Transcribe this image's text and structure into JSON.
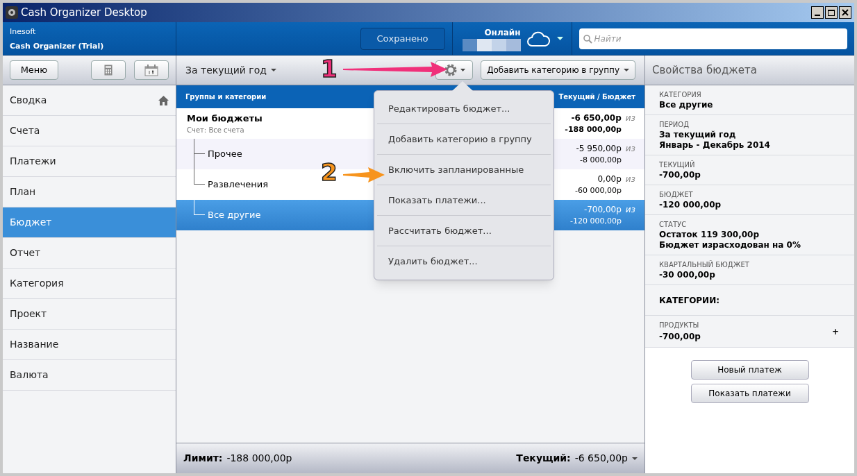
{
  "window": {
    "title": "Cash Organizer Desktop"
  },
  "header": {
    "company": "Inesoft",
    "product": "Cash Organizer (Trial)",
    "save_button": "Сохранено",
    "sync_status": "Онлайн",
    "search": {
      "placeholder": "Найти"
    }
  },
  "toolbar": {
    "menu_button": "Меню",
    "period": "За текущий год",
    "add_category_button": "Добавить категорию в группу",
    "panel_title": "Свойства бюджета"
  },
  "sidebar": {
    "items": [
      {
        "label": "Сводка",
        "selected": false,
        "home": true
      },
      {
        "label": "Счета",
        "selected": false
      },
      {
        "label": "Платежи",
        "selected": false
      },
      {
        "label": "План",
        "selected": false
      },
      {
        "label": "Бюджет",
        "selected": true
      },
      {
        "label": "Отчет",
        "selected": false
      },
      {
        "label": "Категория",
        "selected": false
      },
      {
        "label": "Проект",
        "selected": false
      },
      {
        "label": "Название",
        "selected": false
      },
      {
        "label": "Валюта",
        "selected": false
      }
    ]
  },
  "table": {
    "columns": [
      "Группы и категории",
      "Текущий / Бюджет"
    ],
    "rows": [
      {
        "name": "Мои бюджеты",
        "subtitle": "Счет: Все счета",
        "current": "-6 650,00р",
        "of": "из",
        "budget": "-188 000,00р",
        "selected": false,
        "children": [
          {
            "name": "Прочее",
            "current": "-5 950,00р",
            "of": "из",
            "budget": "-8 000,00р",
            "selected": false
          },
          {
            "name": "Развлечения",
            "current": "0,00р",
            "of": "из",
            "budget": "-60 000,00р",
            "selected": false
          },
          {
            "name": "Все другие",
            "current": "-700,00р",
            "of": "из",
            "budget": "-120 000,00р",
            "selected": true
          }
        ]
      }
    ]
  },
  "footer": {
    "limit_label": "Лимит:",
    "limit_value": "-188 000,00р",
    "current_label": "Текущий:",
    "current_value": "-6 650,00р"
  },
  "menu": {
    "items": [
      "Редактировать бюджет...",
      "Добавить категорию в группу",
      "Включить запланированные",
      "Показать платежи...",
      "Рассчитать бюджет...",
      "Удалить бюджет..."
    ]
  },
  "properties": {
    "fields": [
      {
        "label": "КАТЕГОРИЯ",
        "lines": [
          "Все другие"
        ]
      },
      {
        "label": "ПЕРИОД",
        "lines": [
          "За текущий год",
          "Январь - Декабрь 2014"
        ]
      },
      {
        "label": "ТЕКУЩИЙ",
        "lines": [
          "-700,00р"
        ]
      },
      {
        "label": "БЮДЖЕТ",
        "lines": [
          "-120 000,00р"
        ]
      },
      {
        "label": "СТАТУС",
        "lines": [
          "Остаток 119 300,00р",
          "Бюджет израсходован на 0%"
        ]
      },
      {
        "label": "КВАРТАЛЬНЫЙ БЮДЖЕТ",
        "lines": [
          "-30 000,00р"
        ]
      }
    ],
    "categories_heading": "КАТЕГОРИИ:",
    "categories": [
      {
        "name": "ПРОДУКТЫ",
        "value": "-700,00р",
        "action": "+"
      }
    ],
    "buttons": [
      "Новый платеж",
      "Показать платежи"
    ]
  },
  "annotations": [
    {
      "number": "1",
      "color": "#f0307a"
    },
    {
      "number": "2",
      "color": "#f7941d"
    }
  ]
}
